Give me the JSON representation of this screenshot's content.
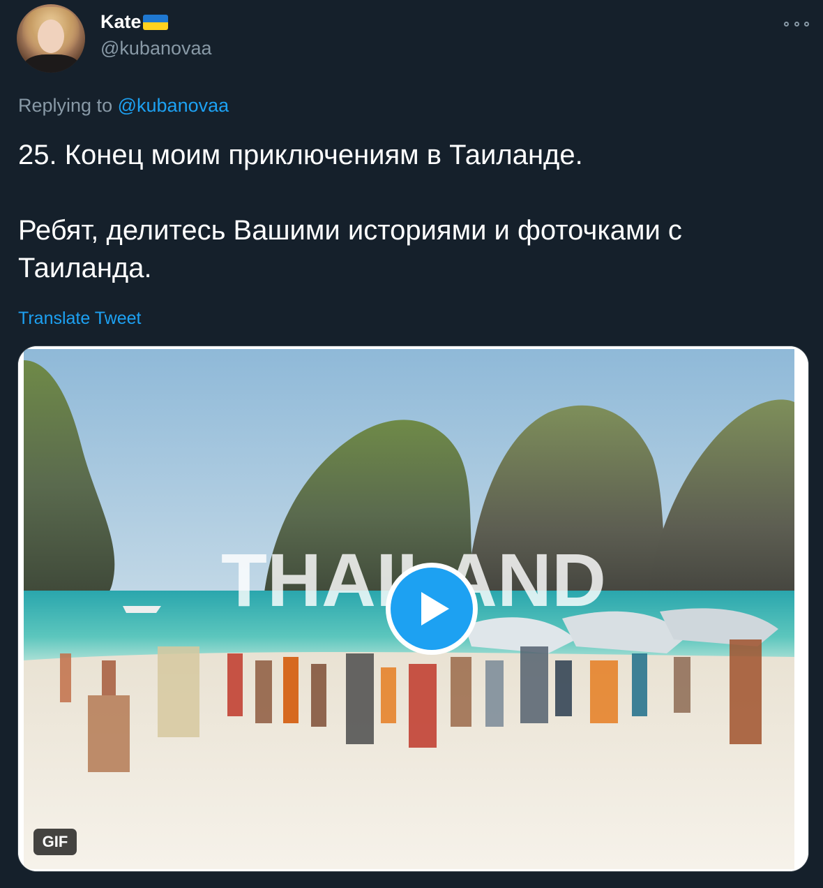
{
  "author": {
    "display_name": "Kate",
    "flag_icon": "ukraine-flag-icon",
    "handle": "@kubanovaa"
  },
  "reply": {
    "prefix": "Replying to",
    "mention": "@kubanovaa"
  },
  "tweet": {
    "paragraphs": [
      "25. Конец моим приключениям в Таиланде.",
      "Ребят, делитесь Вашими историями и фоточками с Таиланда."
    ],
    "translate_label": "Translate Tweet"
  },
  "media": {
    "type_badge": "GIF",
    "overlay_text": "THAILAND",
    "play_icon": "play-icon"
  },
  "colors": {
    "background": "#15202b",
    "accent": "#1da1f2",
    "secondary_text": "#8899a6",
    "flag_blue": "#1f78d1",
    "flag_yellow": "#ffd21f"
  }
}
